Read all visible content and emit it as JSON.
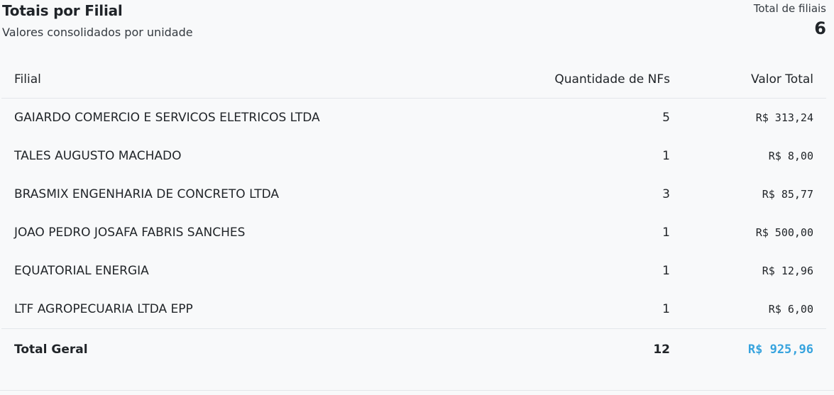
{
  "header": {
    "title": "Totais por Filial",
    "subtitle": "Valores consolidados por unidade",
    "count_label": "Total de filiais",
    "count_value": "6"
  },
  "table": {
    "columns": [
      "Filial",
      "Quantidade de NFs",
      "Valor Total"
    ],
    "rows": [
      {
        "filial": "GAIARDO COMERCIO E SERVICOS ELETRICOS LTDA",
        "qtd": "5",
        "valor": "R$ 313,24"
      },
      {
        "filial": "TALES AUGUSTO MACHADO",
        "qtd": "1",
        "valor": "R$ 8,00"
      },
      {
        "filial": "BRASMIX ENGENHARIA DE CONCRETO LTDA",
        "qtd": "3",
        "valor": "R$ 85,77"
      },
      {
        "filial": "JOAO PEDRO JOSAFA FABRIS SANCHES",
        "qtd": "1",
        "valor": "R$ 500,00"
      },
      {
        "filial": "EQUATORIAL ENERGIA",
        "qtd": "1",
        "valor": "R$ 12,96"
      },
      {
        "filial": "LTF AGROPECUARIA LTDA EPP",
        "qtd": "1",
        "valor": "R$ 6,00"
      }
    ],
    "total": {
      "label": "Total Geral",
      "qtd": "12",
      "valor": "R$ 925,96"
    }
  },
  "colors": {
    "accent": "#36a3de",
    "background": "#f8f9fa",
    "divider": "#e3e6ea"
  }
}
